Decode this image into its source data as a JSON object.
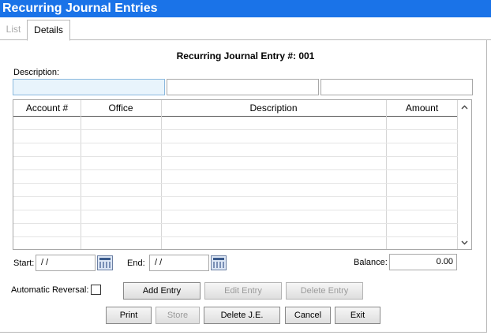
{
  "window": {
    "title": "Recurring Journal Entries"
  },
  "tabs": [
    {
      "label": "List"
    },
    {
      "label": "Details"
    }
  ],
  "form": {
    "heading": "Recurring Journal Entry #: 001",
    "description_label": "Description:",
    "description_values": [
      "",
      "",
      ""
    ]
  },
  "grid": {
    "columns": [
      "Account #",
      "Office",
      "Description",
      "Amount"
    ],
    "rows": []
  },
  "dates": {
    "start_label": "Start:",
    "start_value": " /  /",
    "end_label": "End:",
    "end_value": " /  /"
  },
  "balance": {
    "label": "Balance:",
    "value": "0.00"
  },
  "reversal": {
    "label": "Automatic Reversal:",
    "checked": false
  },
  "buttons": {
    "add_entry": "Add Entry",
    "edit_entry": "Edit Entry",
    "delete_entry": "Delete Entry",
    "print": "Print",
    "store": "Store",
    "delete_je": "Delete J.E.",
    "cancel": "Cancel",
    "exit": "Exit"
  },
  "icons": {
    "scroll_up": "chevron-up-icon",
    "scroll_down": "chevron-down-icon",
    "calendar": "calendar-icon"
  },
  "colors": {
    "titlebar": "#1a73e8",
    "active_input": "#e8f4fc"
  }
}
